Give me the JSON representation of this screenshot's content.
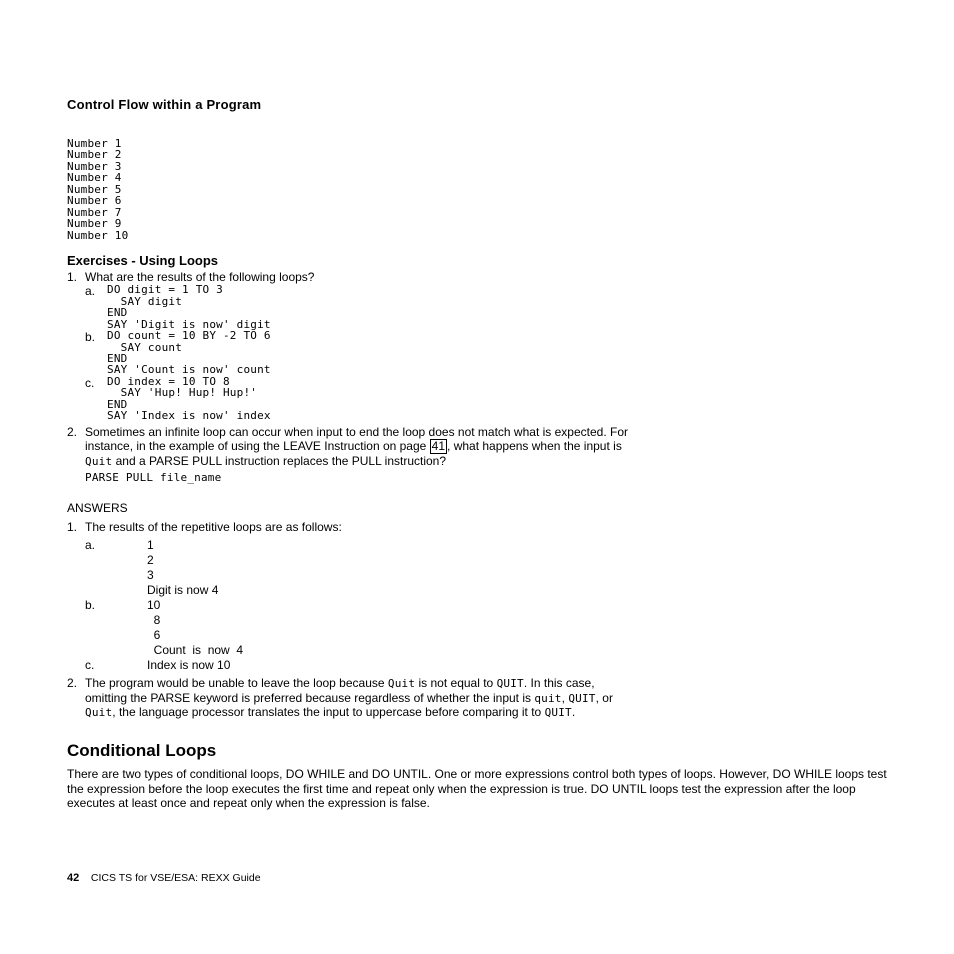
{
  "header": "Control Flow within a Program",
  "numberBlock": "Number 1\nNumber 2\nNumber 3\nNumber 4\nNumber 5\nNumber 6\nNumber 7\nNumber 9\nNumber 10",
  "exercisesTitle": "Exercises - Using Loops",
  "q1": {
    "marker": "1.",
    "text": "What are the results of the following loops?",
    "a": {
      "m": "a.",
      "code": "DO digit = 1 TO 3\n  SAY digit\nEND\nSAY 'Digit is now' digit"
    },
    "b": {
      "m": "b.",
      "code": "DO count = 10 BY -2 TO 6\n  SAY count\nEND\nSAY 'Count is now' count"
    },
    "c": {
      "m": "c.",
      "code": "DO index = 10 TO 8\n  SAY 'Hup! Hup! Hup!'\nEND\nSAY 'Index is now' index"
    }
  },
  "q2": {
    "marker": "2.",
    "line1_a": "Sometimes an infinite loop can occur when input to end the loop does not match what is expected. For",
    "line1_b_pre": "instance, in the example of using the LEAVE Instruction on page ",
    "link": "41",
    "line1_b_post": ", what happens when the input is",
    "line2_pre": "Quit",
    "line2_post": " and a PARSE PULL instruction replaces the PULL instruction?",
    "code": "PARSE PULL file_name"
  },
  "answersTitle": "ANSWERS",
  "a1": {
    "marker": "1.",
    "text": "The results of the repetitive loops are as follows:",
    "rows": [
      {
        "m1": "a.",
        "m2": "",
        "val": "1"
      },
      {
        "m1": "",
        "m2": "",
        "val": "2"
      },
      {
        "m1": "",
        "m2": "",
        "val": "3"
      },
      {
        "m1": "",
        "m2": "",
        "val": "Digit  is  now  4"
      },
      {
        "m1": "b.",
        "m2": "",
        "val": "10"
      },
      {
        "m1": "",
        "m2": "",
        "val": "  8"
      },
      {
        "m1": "",
        "m2": "",
        "val": "  6"
      },
      {
        "m1": "",
        "m2": "",
        "val": "  Count  is  now  4"
      },
      {
        "m1": "c.",
        "m2": "",
        "val": "Index  is  now  10"
      }
    ]
  },
  "a2": {
    "marker": "2.",
    "l1_pre": "The program would be unable to leave the loop because ",
    "l1_c1": "Quit",
    "l1_mid": " is not equal to ",
    "l1_c2": "QUIT",
    "l1_post": ". In this case,",
    "l2_pre": "omitting the PARSE keyword is preferred because regardless of whether the input is ",
    "l2_c1": "quit",
    "l2_s1": ", ",
    "l2_c2": "QUIT",
    "l2_s2": ", or",
    "l3_c1": "Quit",
    "l3_mid": ", the language processor translates the input to uppercase before comparing it to ",
    "l3_c2": "QUIT",
    "l3_post": "."
  },
  "conditional": {
    "title": "Conditional Loops",
    "p": "There are two types of conditional loops, DO WHILE and DO UNTIL. One or more expressions control both types of loops. However, DO WHILE loops test the expression before the loop executes the first time and repeat only when the expression is true. DO UNTIL loops test the expression after the loop executes at least once and repeat only when the expression is false."
  },
  "footer": {
    "pageNum": "42",
    "text": "CICS TS for VSE/ESA:  REXX Guide"
  }
}
